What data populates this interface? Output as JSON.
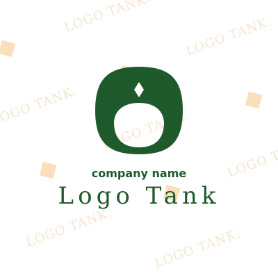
{
  "logo": {
    "company_name": "company name",
    "brand_name": "Logo Tank",
    "mark_color": "#1e5a2c"
  },
  "watermark": {
    "text": "LOGO TANK.",
    "text_color": "#f4e6cf",
    "square_color": "#f9d9b1"
  }
}
